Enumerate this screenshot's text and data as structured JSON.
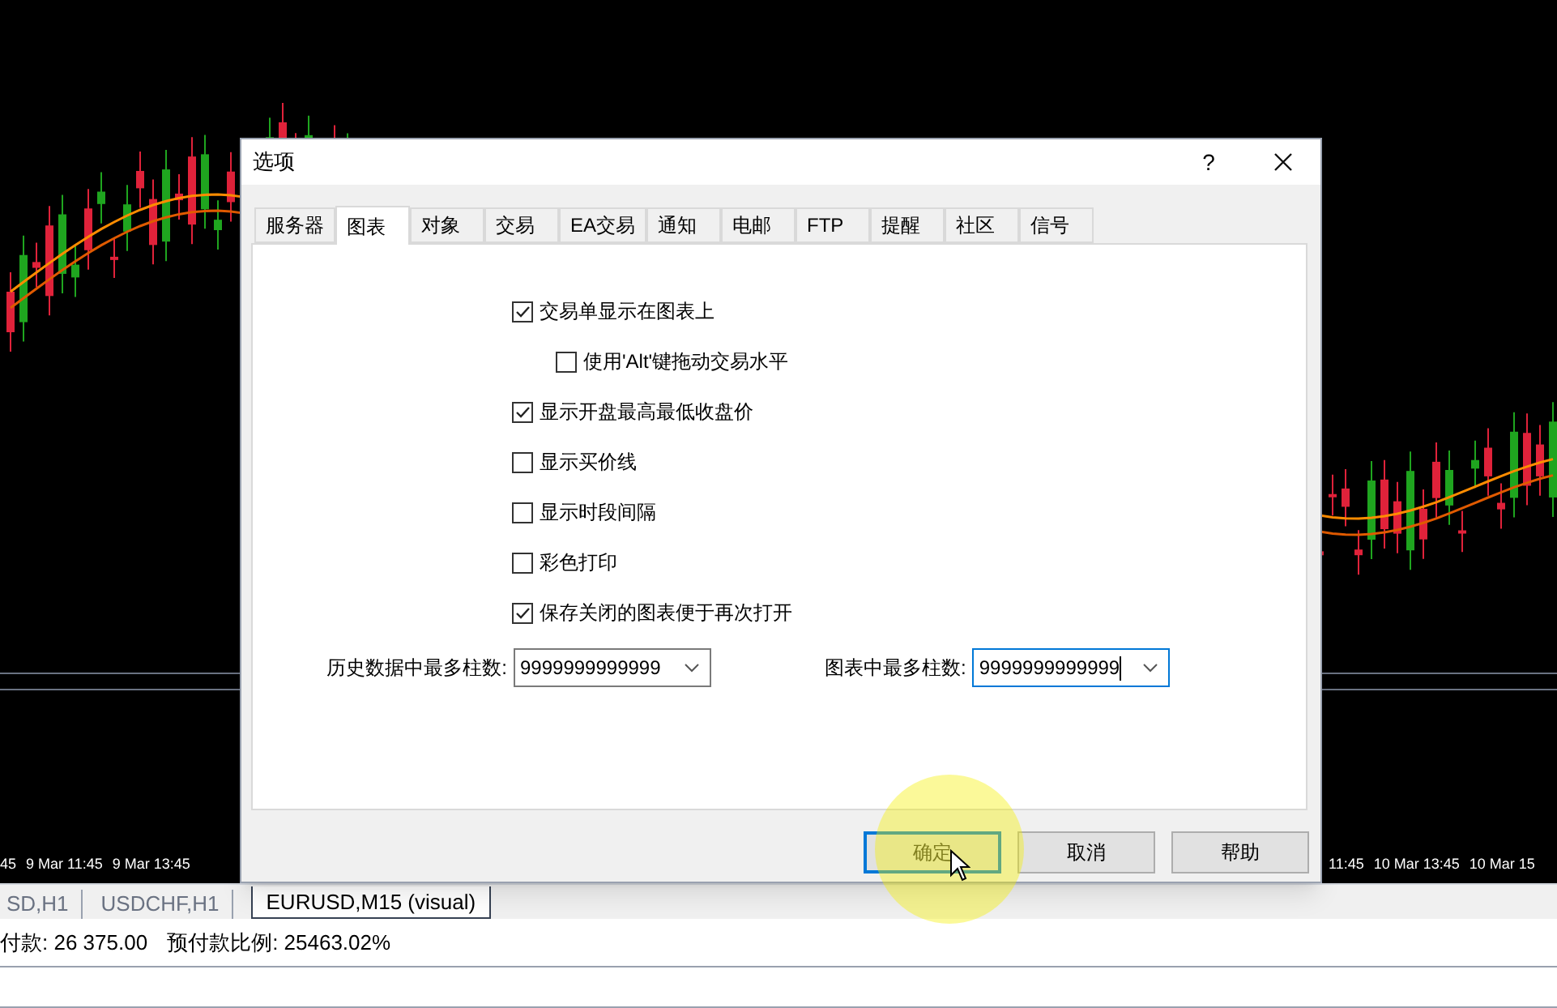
{
  "chart": {
    "time_labels_left": [
      "45",
      "9 Mar 11:45",
      "9 Mar 13:45"
    ],
    "time_labels_right": [
      "11:45",
      "10 Mar 13:45",
      "10 Mar 15"
    ]
  },
  "chart_tabs": [
    {
      "label": "SD,H1",
      "selected": false
    },
    {
      "label": "USDCHF,H1",
      "selected": false
    },
    {
      "label": "EURUSD,M15 (visual)",
      "selected": true
    }
  ],
  "status_bar": {
    "margin": "付款: 26 375.00",
    "margin_level": "预付款比例: 25463.02%"
  },
  "dialog": {
    "title": "选项",
    "help": "?",
    "tabs": [
      {
        "label": "服务器",
        "selected": false
      },
      {
        "label": "图表",
        "selected": true
      },
      {
        "label": "对象",
        "selected": false
      },
      {
        "label": "交易",
        "selected": false
      },
      {
        "label": "EA交易",
        "selected": false
      },
      {
        "label": "通知",
        "selected": false
      },
      {
        "label": "电邮",
        "selected": false
      },
      {
        "label": "FTP",
        "selected": false
      },
      {
        "label": "提醒",
        "selected": false
      },
      {
        "label": "社区",
        "selected": false
      },
      {
        "label": "信号",
        "selected": false
      }
    ],
    "options": [
      {
        "label": "交易单显示在图表上",
        "checked": true,
        "children": [
          {
            "label": "使用'Alt'键拖动交易水平",
            "checked": false
          }
        ]
      },
      {
        "label": "显示开盘最高最低收盘价",
        "checked": true
      },
      {
        "label": "显示买价线",
        "checked": false
      },
      {
        "label": "显示时段间隔",
        "checked": false
      },
      {
        "label": "彩色打印",
        "checked": false
      },
      {
        "label": "保存关闭的图表便于再次打开",
        "checked": true
      }
    ],
    "fields": [
      {
        "label": "历史数据中最多柱数:",
        "value": "9999999999999",
        "focused": false
      },
      {
        "label": "图表中最多柱数:",
        "value": "9999999999999",
        "focused": true
      }
    ],
    "buttons": [
      {
        "label": "确定",
        "default": true
      },
      {
        "label": "取消",
        "default": false
      },
      {
        "label": "帮助",
        "default": false
      }
    ]
  }
}
